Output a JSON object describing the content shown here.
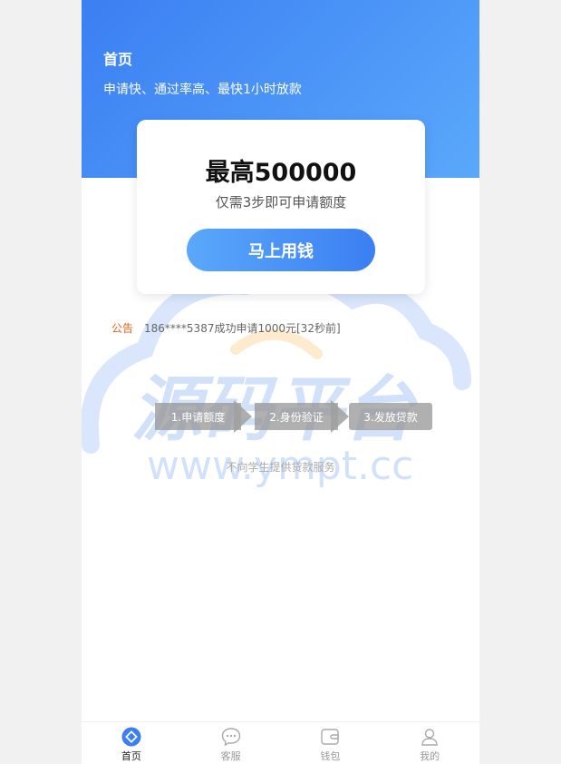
{
  "header": {
    "title": "首页",
    "subtitle": "申请快、通过率高、最快1小时放款"
  },
  "card": {
    "amount": "最高500000",
    "description": "仅需3步即可申请额度",
    "cta_label": "马上用钱"
  },
  "notice": {
    "label": "公告",
    "text": "186****5387成功申请1000元[32秒前]"
  },
  "watermark": {
    "cn_text": "源码平台",
    "url_text": "www.ympt.cc"
  },
  "steps": [
    {
      "label": "1.申请额度"
    },
    {
      "label": "2.身份验证"
    },
    {
      "label": "3.发放贷款"
    }
  ],
  "disclaimer": "不向学生提供贷款服务",
  "tabbar": {
    "items": [
      {
        "label": "首页",
        "icon": "home-icon",
        "active": true
      },
      {
        "label": "客服",
        "icon": "chat-icon",
        "active": false
      },
      {
        "label": "钱包",
        "icon": "wallet-icon",
        "active": false
      },
      {
        "label": "我的",
        "icon": "user-icon",
        "active": false
      }
    ]
  },
  "colors": {
    "accent": "#3b7ff2",
    "accent_light": "#5aa8fb",
    "notice_label": "#e2651c"
  }
}
